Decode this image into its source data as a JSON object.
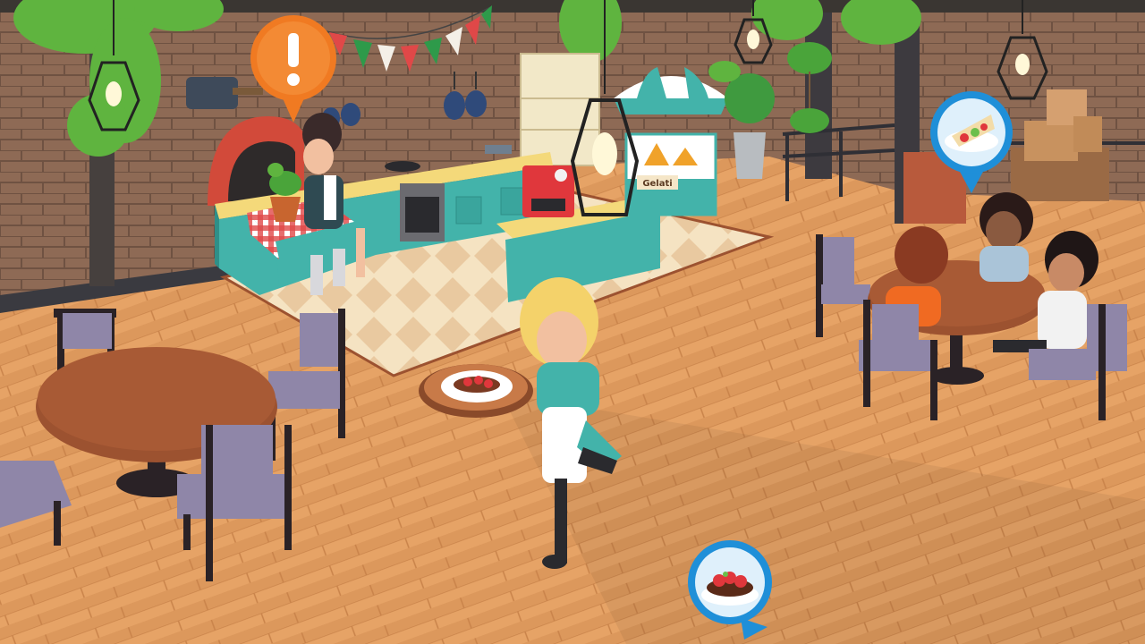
{
  "scene": {
    "setting": "restaurant-dining-room",
    "colors": {
      "floor": "#e6a366",
      "wall_brick": "#8e6a55",
      "counter_teal": "#43b3aa",
      "table_wood": "#9c5230",
      "chair_lavender": "#8f86a8",
      "alert_orange": "#f07a22",
      "order_blue": "#1f8fd8"
    }
  },
  "gelato_stand": {
    "sign_text": "Gelati"
  },
  "markers": {
    "alert": {
      "icon": "exclamation-icon",
      "glyph": "!"
    },
    "customer_order": {
      "icon": "wrap-dish-icon",
      "dish": "wrap"
    },
    "serve_target": {
      "icon": "bruschetta-dish-icon",
      "dish": "bruschetta"
    }
  },
  "characters": {
    "chef": {
      "role": "chef"
    },
    "waitress": {
      "role": "waitress",
      "carrying": "bruschetta"
    },
    "customers": [
      {
        "seat": "left"
      },
      {
        "seat": "back"
      },
      {
        "seat": "right"
      }
    ]
  }
}
